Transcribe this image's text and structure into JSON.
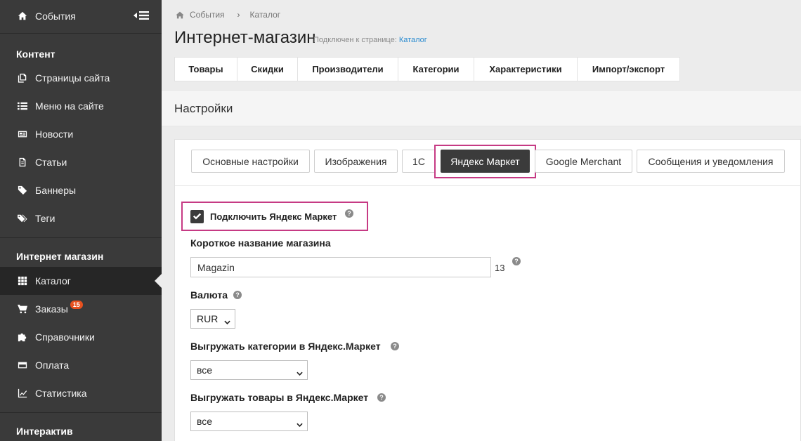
{
  "sidebar": {
    "top_item": "События",
    "sections": {
      "content": "Контент",
      "shop": "Интернет магазин",
      "interactive": "Интерактив"
    },
    "content_items": [
      "Страницы сайта",
      "Меню на сайте",
      "Новости",
      "Статьи",
      "Баннеры",
      "Теги"
    ],
    "shop_items": [
      "Каталог",
      "Заказы",
      "Справочники",
      "Оплата",
      "Статистика"
    ],
    "orders_badge": "15",
    "active_item": "Каталог"
  },
  "breadcrumb": {
    "home": "События",
    "current": "Каталог"
  },
  "header": {
    "title": "Интернет-магазин",
    "connected_prefix": "Подключен к странице:",
    "connected_link": "Каталог"
  },
  "top_tabs": [
    "Товары",
    "Скидки",
    "Производители",
    "Категории",
    "Характеристики",
    "Импорт/экспорт"
  ],
  "settings_title": "Настройки",
  "sub_tabs": [
    "Основные настройки",
    "Изображения",
    "1С",
    "Яндекс Маркет",
    "Google Merchant",
    "Сообщения и уведомления"
  ],
  "active_sub_tab": "Яндекс Маркет",
  "form": {
    "enable_label": "Подключить Яндекс Маркет",
    "enable_checked": true,
    "shop_name_label": "Короткое название магазина",
    "shop_name_value": "Magazin",
    "shop_name_count": "13",
    "currency_label": "Валюта",
    "currency_value": "RUR",
    "export_categories_label": "Выгружать категории в Яндекс.Маркет",
    "export_categories_value": "все",
    "export_products_label": "Выгружать товары в Яндекс.Маркет",
    "export_products_value": "все"
  },
  "colors": {
    "sidebar_bg": "#3a3a3a",
    "active_bg": "#262626",
    "highlight": "#c63a84",
    "badge": "#e8511f",
    "link": "#2a8bd0"
  }
}
